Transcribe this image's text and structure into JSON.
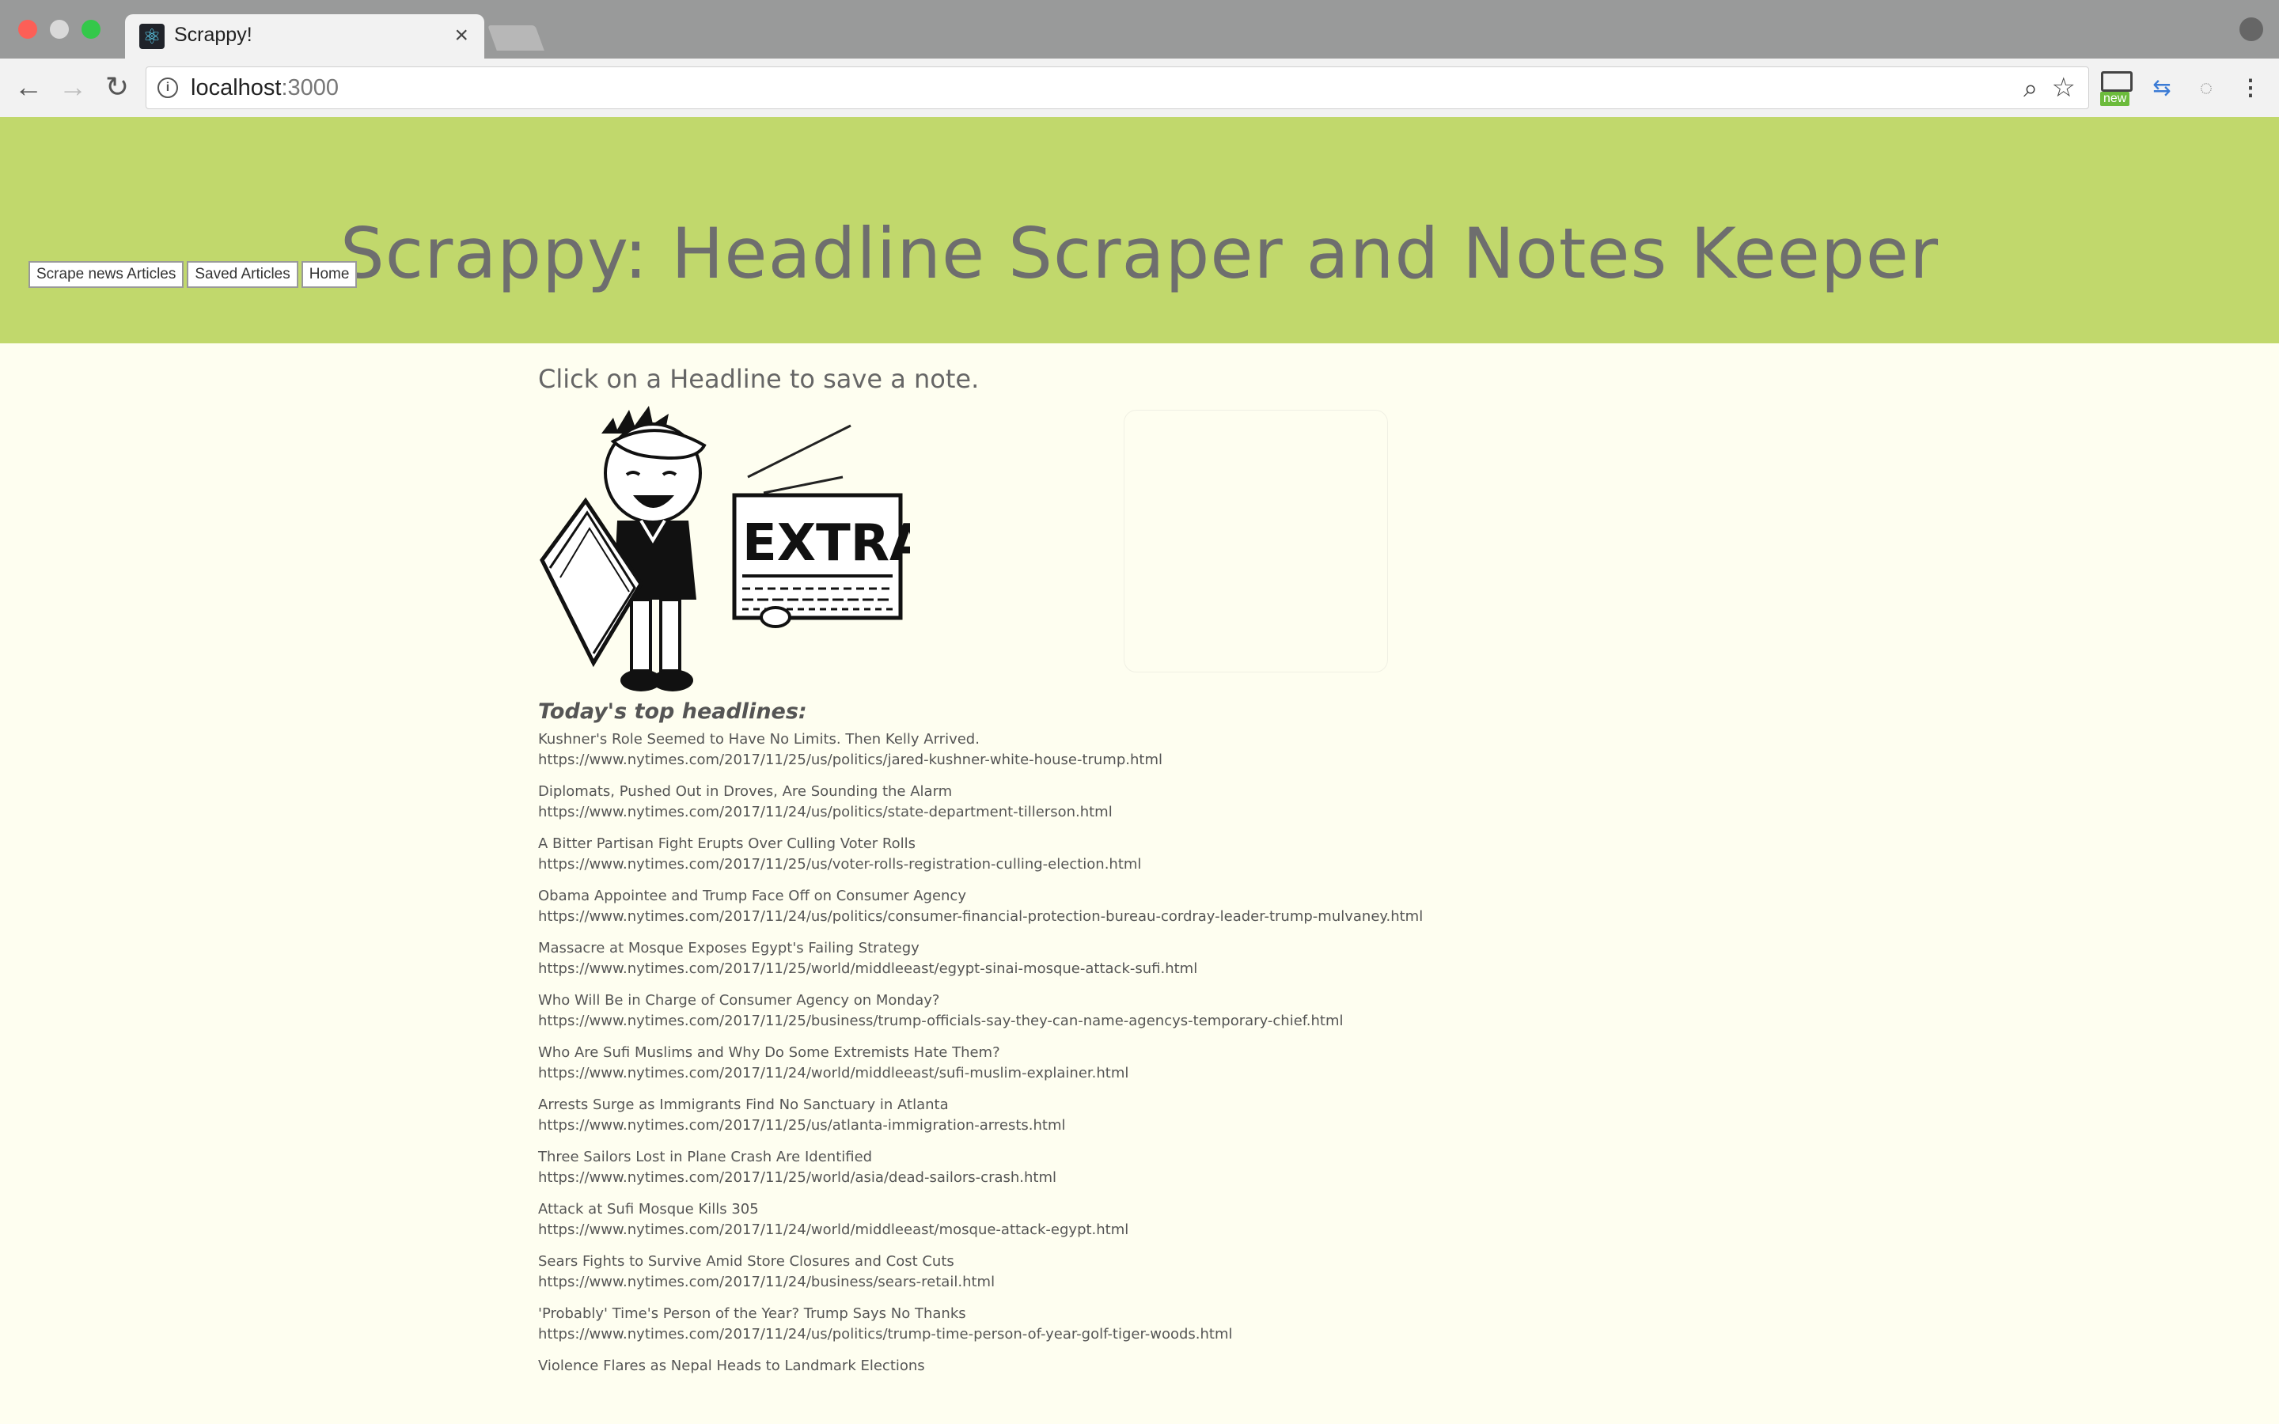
{
  "browser": {
    "tab_title": "Scrappy!",
    "tab_close": "×",
    "url_host": "localhost",
    "url_port": ":3000",
    "ext_badge": "new"
  },
  "header": {
    "title": "Scrappy: Headline Scraper and Notes Keeper",
    "bg_color": "#c1d86c",
    "buttons": [
      "Scrape news Articles",
      "Saved Articles",
      "Home"
    ]
  },
  "main": {
    "instruction": "Click on a Headline to save a note.",
    "illustration_text": "EXTRA!",
    "headlines_title": "Today's top headlines:",
    "articles": [
      {
        "headline": "Kushner's Role Seemed to Have No Limits. Then Kelly Arrived.",
        "link": "https://www.nytimes.com/2017/11/25/us/politics/jared-kushner-white-house-trump.html"
      },
      {
        "headline": "Diplomats, Pushed Out in Droves, Are Sounding the Alarm",
        "link": "https://www.nytimes.com/2017/11/24/us/politics/state-department-tillerson.html"
      },
      {
        "headline": "A Bitter Partisan Fight Erupts Over Culling Voter Rolls",
        "link": "https://www.nytimes.com/2017/11/25/us/voter-rolls-registration-culling-election.html"
      },
      {
        "headline": "Obama Appointee and Trump Face Off on Consumer Agency",
        "link": "https://www.nytimes.com/2017/11/24/us/politics/consumer-financial-protection-bureau-cordray-leader-trump-mulvaney.html"
      },
      {
        "headline": "Massacre at Mosque Exposes Egypt's Failing Strategy",
        "link": "https://www.nytimes.com/2017/11/25/world/middleeast/egypt-sinai-mosque-attack-sufi.html"
      },
      {
        "headline": "Who Will Be in Charge of Consumer Agency on Monday?",
        "link": "https://www.nytimes.com/2017/11/25/business/trump-officials-say-they-can-name-agencys-temporary-chief.html"
      },
      {
        "headline": "Who Are Sufi Muslims and Why Do Some Extremists Hate Them?",
        "link": "https://www.nytimes.com/2017/11/24/world/middleeast/sufi-muslim-explainer.html"
      },
      {
        "headline": "Arrests Surge as Immigrants Find No Sanctuary in Atlanta",
        "link": "https://www.nytimes.com/2017/11/25/us/atlanta-immigration-arrests.html"
      },
      {
        "headline": "Three Sailors Lost in Plane Crash Are Identified",
        "link": "https://www.nytimes.com/2017/11/25/world/asia/dead-sailors-crash.html"
      },
      {
        "headline": "Attack at Sufi Mosque Kills 305",
        "link": "https://www.nytimes.com/2017/11/24/world/middleeast/mosque-attack-egypt.html"
      },
      {
        "headline": "Sears Fights to Survive Amid Store Closures and Cost Cuts",
        "link": "https://www.nytimes.com/2017/11/24/business/sears-retail.html"
      },
      {
        "headline": "'Probably' Time's Person of the Year? Trump Says No Thanks",
        "link": "https://www.nytimes.com/2017/11/24/us/politics/trump-time-person-of-year-golf-tiger-woods.html"
      },
      {
        "headline": "Violence Flares as Nepal Heads to Landmark Elections",
        "link": ""
      }
    ]
  }
}
